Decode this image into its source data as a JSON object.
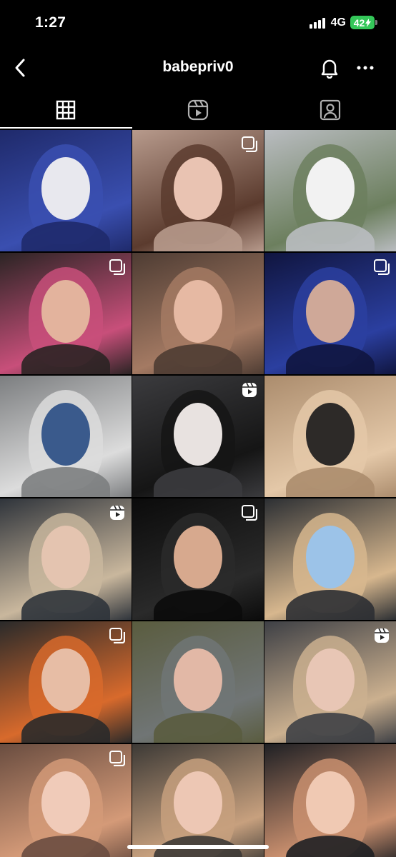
{
  "status_bar": {
    "time": "1:27",
    "network": "4G",
    "battery": "42"
  },
  "header": {
    "title": "babepriv0"
  },
  "tabs": [
    {
      "name": "grid-icon",
      "active": true
    },
    {
      "name": "reels-icon",
      "active": false
    },
    {
      "name": "tagged-icon",
      "active": false
    }
  ],
  "posts": [
    {
      "badge": "none",
      "colors": [
        "#1f2a6b",
        "#3a4fb0",
        "#e8e8ee"
      ]
    },
    {
      "badge": "carousel",
      "colors": [
        "#b79a8c",
        "#5b3b2e",
        "#e9c3b2"
      ]
    },
    {
      "badge": "none",
      "colors": [
        "#b9bcc0",
        "#6c7f5e",
        "#f2f2f2"
      ]
    },
    {
      "badge": "carousel",
      "colors": [
        "#2b2424",
        "#c84f7a",
        "#e3b39d"
      ]
    },
    {
      "badge": "none",
      "colors": [
        "#4e3c33",
        "#a47a63",
        "#e6b9a3"
      ]
    },
    {
      "badge": "carousel",
      "colors": [
        "#10153f",
        "#2b3fa0",
        "#cfa898"
      ]
    },
    {
      "badge": "none",
      "colors": [
        "#7c7e80",
        "#dcdcdc",
        "#3a5a8c"
      ]
    },
    {
      "badge": "reel",
      "colors": [
        "#3b3b3e",
        "#151515",
        "#e8e2e0"
      ]
    },
    {
      "badge": "none",
      "colors": [
        "#ab8c6d",
        "#e4c8a8",
        "#2d2a28"
      ]
    },
    {
      "badge": "reel",
      "colors": [
        "#2f343b",
        "#c9b79d",
        "#e4c4b0"
      ]
    },
    {
      "badge": "carousel",
      "colors": [
        "#0b0b0b",
        "#2a2a2a",
        "#d7a98e"
      ]
    },
    {
      "badge": "none",
      "colors": [
        "#2c2f33",
        "#d7b78e",
        "#9cc3e8"
      ]
    },
    {
      "badge": "carousel",
      "colors": [
        "#2a2a2a",
        "#d86a2c",
        "#e7bda5"
      ]
    },
    {
      "badge": "none",
      "colors": [
        "#5a5c3f",
        "#707575",
        "#e2b8a6"
      ]
    },
    {
      "badge": "reel",
      "colors": [
        "#3e4045",
        "#cbb08f",
        "#e8c6b5"
      ]
    },
    {
      "badge": "carousel",
      "colors": [
        "#6a4d40",
        "#d49a78",
        "#f0cbb9"
      ]
    },
    {
      "badge": "none",
      "colors": [
        "#3d3a36",
        "#c7a07e",
        "#edc7b4"
      ]
    },
    {
      "badge": "none",
      "colors": [
        "#1f2024",
        "#c98f6e",
        "#f0c9b3"
      ]
    }
  ]
}
